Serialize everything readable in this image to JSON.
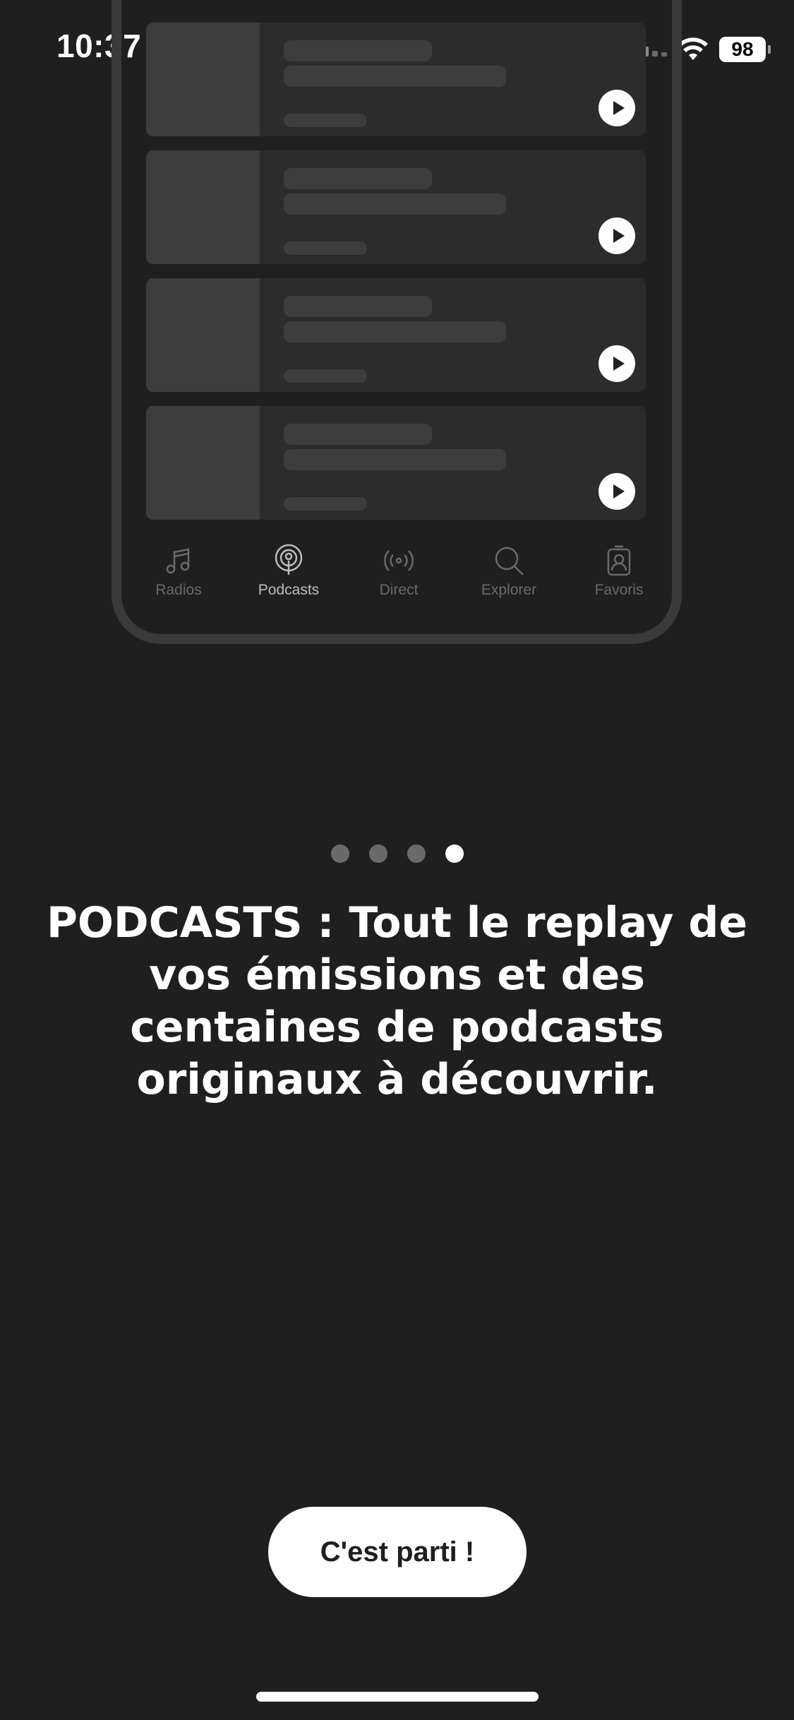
{
  "status_bar": {
    "time": "10:37",
    "battery": "98"
  },
  "mockup": {
    "cards": [
      {},
      {},
      {},
      {}
    ],
    "tabs": [
      {
        "label": "Radios",
        "icon": "music-note-icon",
        "active": false
      },
      {
        "label": "Podcasts",
        "icon": "podcast-icon",
        "active": true
      },
      {
        "label": "Direct",
        "icon": "broadcast-icon",
        "active": false
      },
      {
        "label": "Explorer",
        "icon": "search-icon",
        "active": false
      },
      {
        "label": "Favoris",
        "icon": "favorites-icon",
        "active": false
      }
    ]
  },
  "pager": {
    "count": 4,
    "active_index": 3
  },
  "headline": "PODCASTS : Tout le replay de vos émissions et des centaines de podcasts originaux à découvrir.",
  "cta_label": "C'est parti !"
}
